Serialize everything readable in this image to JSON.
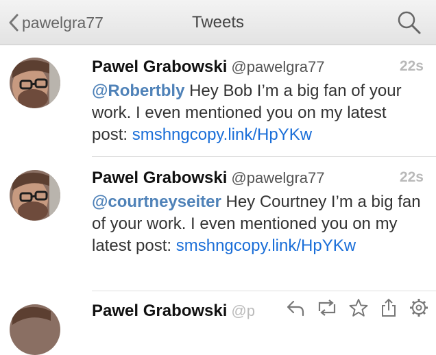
{
  "nav": {
    "back_label": "pawelgra77",
    "title": "Tweets"
  },
  "tweets": [
    {
      "name": "Pawel Grabowski",
      "handle": "@pawelgra77",
      "time": "22s",
      "mention": "@Robertbly",
      "text": " Hey Bob I’m a big fan of your work. I even mentioned you on my latest post: ",
      "link": "smshngcopy.link/HpYKw"
    },
    {
      "name": "Pawel Grabowski",
      "handle": "@pawelgra77",
      "time": "22s",
      "mention": "@courtneyseiter",
      "text": " Hey Courtney I’m a big fan of your work. I even mentioned you on my latest post: ",
      "link": "smshngcopy.link/HpYKw"
    },
    {
      "name": "Pawel Grabowski",
      "handle": "@p"
    }
  ],
  "icons": [
    "chevron-left-icon",
    "search-icon",
    "reply-icon",
    "retweet-icon",
    "favorite-star-icon",
    "share-icon",
    "gear-icon"
  ],
  "colors": {
    "mention": "#4f82b8",
    "link": "#1a6ed8",
    "time": "#b9b9b9"
  }
}
